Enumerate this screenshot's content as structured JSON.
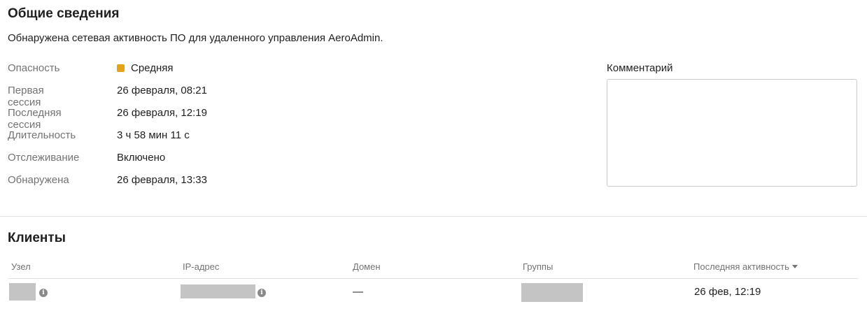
{
  "general": {
    "title": "Общие сведения",
    "description": "Обнаружена сетевая активность ПО для удаленного управления AeroAdmin.",
    "properties": [
      {
        "label": "Опасность",
        "value": "Средняя"
      },
      {
        "label": "Первая сессия",
        "value": "26 февраля, 08:21"
      },
      {
        "label": "Последняя сессия",
        "value": "26 февраля, 12:19"
      },
      {
        "label": "Длительность",
        "value": "3 ч 58 мин 11 с"
      },
      {
        "label": "Отслеживание",
        "value": "Включено"
      },
      {
        "label": "Обнаружена",
        "value": "26 февраля, 13:33"
      }
    ],
    "danger_color": "#e6a317",
    "comment_label": "Комментарий",
    "comment_value": ""
  },
  "clients": {
    "title": "Клиенты",
    "columns": [
      "Узел",
      "IP-адрес",
      "Домен",
      "Группы",
      "Последняя активность"
    ],
    "sorted_column": "Последняя активность",
    "sort_direction": "desc",
    "rows": [
      {
        "node": "",
        "ip": "",
        "domain": "—",
        "groups": "",
        "last_activity": "26 фев, 12:19"
      }
    ],
    "info_icon": "info-icon"
  }
}
